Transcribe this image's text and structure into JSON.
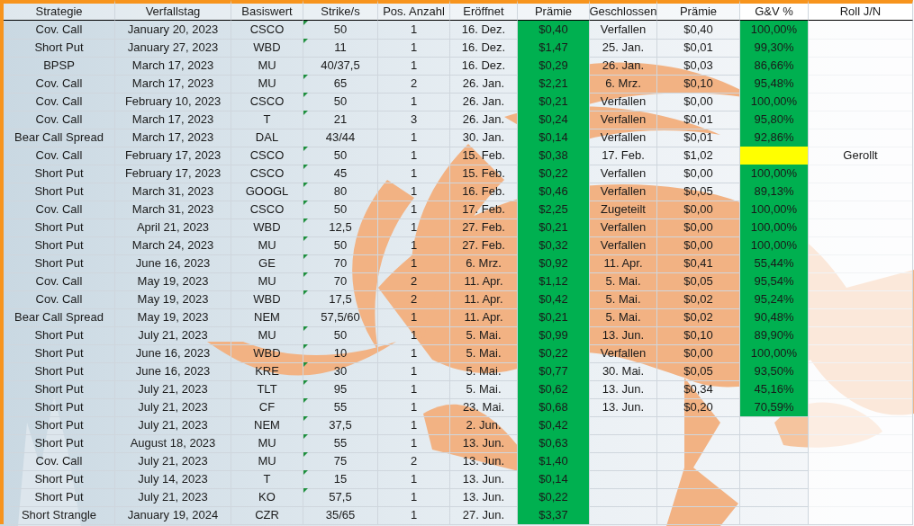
{
  "columns": [
    "Strategie",
    "Verfallstag",
    "Basiswert",
    "Strike/s",
    "Pos. Anzahl",
    "Eröffnet",
    "Prämie",
    "Geschlossen",
    "Prämie",
    "G&V %",
    "Roll J/N"
  ],
  "rows": [
    {
      "strategy": "Cov. Call",
      "expiry": "January 20, 2023",
      "underlying": "CSCO",
      "strike": "50",
      "text_warning": true,
      "count": "1",
      "opened": "16. Dez.",
      "premium": "$0,40",
      "closed": "Verfallen",
      "close_premium": "$0,40",
      "pnl": "100,00%",
      "color": "#00b050"
    },
    {
      "strategy": "Short Put",
      "expiry": "January 27, 2023",
      "underlying": "WBD",
      "strike": "11",
      "text_warning": true,
      "count": "1",
      "opened": "16. Dez.",
      "premium": "$1,47",
      "closed": "25. Jan.",
      "close_premium": "$0,01",
      "pnl": "99,30%",
      "color": "#00b050"
    },
    {
      "strategy": "BPSP",
      "expiry": "March 17, 2023",
      "underlying": "MU",
      "strike": "40/37,5",
      "text_warning": false,
      "count": "1",
      "opened": "16. Dez.",
      "premium": "$0,29",
      "closed": "26. Jan.",
      "close_premium": "$0,03",
      "pnl": "86,66%",
      "color": "#00b050"
    },
    {
      "strategy": "Cov. Call",
      "expiry": "March 17, 2023",
      "underlying": "MU",
      "strike": "65",
      "text_warning": true,
      "count": "2",
      "opened": "26. Jan.",
      "premium": "$2,21",
      "closed": "6. Mrz.",
      "close_premium": "$0,10",
      "pnl": "95,48%",
      "color": "#00b050"
    },
    {
      "strategy": "Cov. Call",
      "expiry": "February 10, 2023",
      "underlying": "CSCO",
      "strike": "50",
      "text_warning": true,
      "count": "1",
      "opened": "26. Jan.",
      "premium": "$0,21",
      "closed": "Verfallen",
      "close_premium": "$0,00",
      "pnl": "100,00%",
      "color": "#00b050"
    },
    {
      "strategy": "Cov. Call",
      "expiry": "March 17, 2023",
      "underlying": "T",
      "strike": "21",
      "text_warning": true,
      "count": "3",
      "opened": "26. Jan.",
      "premium": "$0,24",
      "closed": "Verfallen",
      "close_premium": "$0,01",
      "pnl": "95,80%",
      "color": "#00b050"
    },
    {
      "strategy": "Bear Call Spread",
      "expiry": "March 17, 2023",
      "underlying": "DAL",
      "strike": "43/44",
      "text_warning": false,
      "count": "1",
      "opened": "30. Jan.",
      "premium": "$0,14",
      "closed": "Verfallen",
      "close_premium": "$0,01",
      "pnl": "92,86%",
      "color": "#00b050"
    },
    {
      "strategy": "Cov. Call",
      "expiry": "February 17, 2023",
      "underlying": "CSCO",
      "strike": "50",
      "text_warning": true,
      "count": "1",
      "opened": "15. Feb.",
      "premium": "$0,38",
      "closed": "17. Feb.",
      "close_premium": "$1,02",
      "color": "#ffff00",
      "roll": "Gerollt"
    },
    {
      "strategy": "Short Put",
      "expiry": "February 17, 2023",
      "underlying": "CSCO",
      "strike": "45",
      "text_warning": true,
      "count": "1",
      "opened": "15. Feb.",
      "premium": "$0,22",
      "closed": "Verfallen",
      "close_premium": "$0,00",
      "pnl": "100,00%",
      "color": "#00b050"
    },
    {
      "strategy": "Short Put",
      "expiry": "March 31, 2023",
      "underlying": "GOOGL",
      "strike": "80",
      "text_warning": true,
      "count": "1",
      "opened": "16. Feb.",
      "premium": "$0,46",
      "closed": "Verfallen",
      "close_premium": "$0,05",
      "pnl": "89,13%",
      "color": "#00b050"
    },
    {
      "strategy": "Cov. Call",
      "expiry": "March 31, 2023",
      "underlying": "CSCO",
      "strike": "50",
      "text_warning": true,
      "count": "1",
      "opened": "17. Feb.",
      "premium": "$2,25",
      "closed": "Zugeteilt",
      "close_premium": "$0,00",
      "pnl": "100,00%",
      "color": "#00b050"
    },
    {
      "strategy": "Short Put",
      "expiry": "April 21, 2023",
      "underlying": "WBD",
      "strike": "12,5",
      "text_warning": true,
      "count": "1",
      "opened": "27. Feb.",
      "premium": "$0,21",
      "closed": "Verfallen",
      "close_premium": "$0,00",
      "pnl": "100,00%",
      "color": "#00b050"
    },
    {
      "strategy": "Short Put",
      "expiry": "March 24, 2023",
      "underlying": "MU",
      "strike": "50",
      "text_warning": true,
      "count": "1",
      "opened": "27. Feb.",
      "premium": "$0,32",
      "closed": "Verfallen",
      "close_premium": "$0,00",
      "pnl": "100,00%",
      "color": "#00b050"
    },
    {
      "strategy": "Short Put",
      "expiry": "June 16, 2023",
      "underlying": "GE",
      "strike": "70",
      "text_warning": true,
      "count": "1",
      "opened": "6. Mrz.",
      "premium": "$0,92",
      "closed": "11. Apr.",
      "close_premium": "$0,41",
      "pnl": "55,44%",
      "color": "#00b050"
    },
    {
      "strategy": "Cov. Call",
      "expiry": "May 19, 2023",
      "underlying": "MU",
      "strike": "70",
      "text_warning": true,
      "count": "2",
      "opened": "11. Apr.",
      "premium": "$1,12",
      "closed": "5. Mai.",
      "close_premium": "$0,05",
      "pnl": "95,54%",
      "color": "#00b050"
    },
    {
      "strategy": "Cov. Call",
      "expiry": "May 19, 2023",
      "underlying": "WBD",
      "strike": "17,5",
      "text_warning": true,
      "count": "2",
      "opened": "11. Apr.",
      "premium": "$0,42",
      "closed": "5. Mai.",
      "close_premium": "$0,02",
      "pnl": "95,24%",
      "color": "#00b050"
    },
    {
      "strategy": "Bear Call Spread",
      "expiry": "May 19, 2023",
      "underlying": "NEM",
      "strike": "57,5/60",
      "text_warning": false,
      "count": "1",
      "opened": "11. Apr.",
      "premium": "$0,21",
      "closed": "5. Mai.",
      "close_premium": "$0,02",
      "pnl": "90,48%",
      "color": "#00b050"
    },
    {
      "strategy": "Short Put",
      "expiry": "July 21, 2023",
      "underlying": "MU",
      "strike": "50",
      "text_warning": true,
      "count": "1",
      "opened": "5. Mai.",
      "premium": "$0,99",
      "closed": "13. Jun.",
      "close_premium": "$0,10",
      "pnl": "89,90%",
      "color": "#00b050"
    },
    {
      "strategy": "Short Put",
      "expiry": "June 16, 2023",
      "underlying": "WBD",
      "strike": "10",
      "text_warning": true,
      "count": "1",
      "opened": "5. Mai.",
      "premium": "$0,22",
      "closed": "Verfallen",
      "close_premium": "$0,00",
      "pnl": "100,00%",
      "color": "#00b050"
    },
    {
      "strategy": "Short Put",
      "expiry": "June 16, 2023",
      "underlying": "KRE",
      "strike": "30",
      "text_warning": true,
      "count": "1",
      "opened": "5. Mai.",
      "premium": "$0,77",
      "closed": "30. Mai.",
      "close_premium": "$0,05",
      "pnl": "93,50%",
      "color": "#00b050"
    },
    {
      "strategy": "Short Put",
      "expiry": "July 21, 2023",
      "underlying": "TLT",
      "strike": "95",
      "text_warning": true,
      "count": "1",
      "opened": "5. Mai.",
      "premium": "$0,62",
      "closed": "13. Jun.",
      "close_premium": "$0,34",
      "pnl": "45,16%",
      "color": "#00b050"
    },
    {
      "strategy": "Short Put",
      "expiry": "July 21, 2023",
      "underlying": "CF",
      "strike": "55",
      "text_warning": true,
      "count": "1",
      "opened": "23. Mai.",
      "premium": "$0,68",
      "closed": "13. Jun.",
      "close_premium": "$0,20",
      "pnl": "70,59%",
      "color": "#00b050"
    },
    {
      "strategy": "Short Put",
      "expiry": "July 21, 2023",
      "underlying": "NEM",
      "strike": "37,5",
      "text_warning": true,
      "count": "1",
      "opened": "2. Jun.",
      "premium": "$0,42"
    },
    {
      "strategy": "Short Put",
      "expiry": "August 18, 2023",
      "underlying": "MU",
      "strike": "55",
      "text_warning": true,
      "count": "1",
      "opened": "13. Jun.",
      "premium": "$0,63"
    },
    {
      "strategy": "Cov. Call",
      "expiry": "July 21, 2023",
      "underlying": "MU",
      "strike": "75",
      "text_warning": true,
      "count": "2",
      "opened": "13. Jun.",
      "premium": "$1,40"
    },
    {
      "strategy": "Short Put",
      "expiry": "July 14, 2023",
      "underlying": "T",
      "strike": "15",
      "text_warning": true,
      "count": "1",
      "opened": "13. Jun.",
      "premium": "$0,14"
    },
    {
      "strategy": "Short Put",
      "expiry": "July 21, 2023",
      "underlying": "KO",
      "strike": "57,5",
      "text_warning": true,
      "count": "1",
      "opened": "13. Jun.",
      "premium": "$0,22"
    },
    {
      "strategy": "Short Strangle",
      "expiry": "January 19, 2024",
      "underlying": "CZR",
      "strike": "35/65",
      "text_warning": false,
      "count": "1",
      "opened": "27. Jun.",
      "premium": "$3,37"
    }
  ]
}
